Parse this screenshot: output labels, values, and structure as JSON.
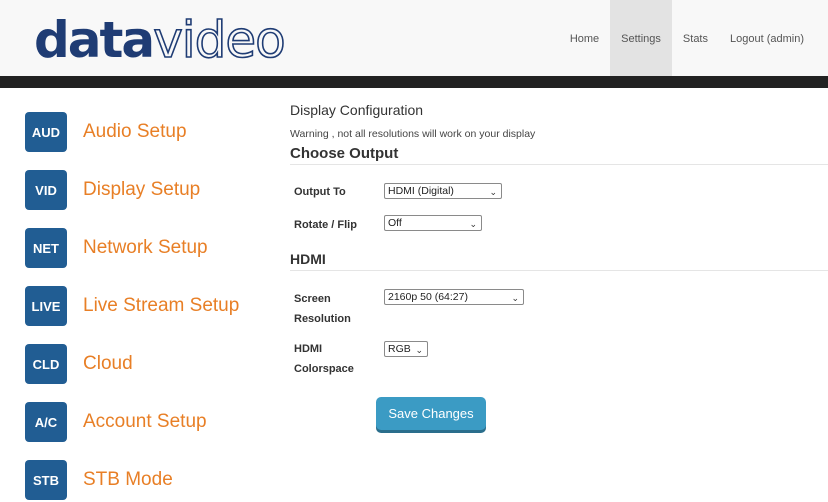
{
  "brand": {
    "logo_bold": "data",
    "logo_light": "video"
  },
  "nav": {
    "home": "Home",
    "settings": "Settings",
    "stats": "Stats",
    "logout": "Logout (admin)"
  },
  "sidebar": {
    "items": [
      {
        "badge": "AUD",
        "label": "Audio Setup"
      },
      {
        "badge": "VID",
        "label": "Display Setup"
      },
      {
        "badge": "NET",
        "label": "Network Setup"
      },
      {
        "badge": "LIVE",
        "label": "Live Stream Setup"
      },
      {
        "badge": "CLD",
        "label": "Cloud"
      },
      {
        "badge": "A/C",
        "label": "Account Setup"
      },
      {
        "badge": "STB",
        "label": "STB Mode"
      }
    ]
  },
  "main": {
    "title": "Display Configuration",
    "warning": "Warning , not all resolutions will work on your display",
    "choose_output_heading": "Choose Output",
    "output_to": {
      "label": "Output To",
      "value": "HDMI (Digital)"
    },
    "rotate_flip": {
      "label": "Rotate / Flip",
      "value": "Off"
    },
    "hdmi_heading": "HDMI",
    "screen_resolution": {
      "label_line1": "Screen",
      "label_line2": "Resolution",
      "value": "2160p 50 (64:27)"
    },
    "hdmi_colorspace": {
      "label_line1": "HDMI",
      "label_line2": "Colorspace",
      "value": "RGB"
    },
    "save_button": "Save Changes"
  },
  "colors": {
    "brand_blue": "#1f3c74",
    "badge_blue": "#215d93",
    "label_orange": "#e87f26",
    "button_blue": "#3b9bc4",
    "dark_bar": "#222222"
  }
}
